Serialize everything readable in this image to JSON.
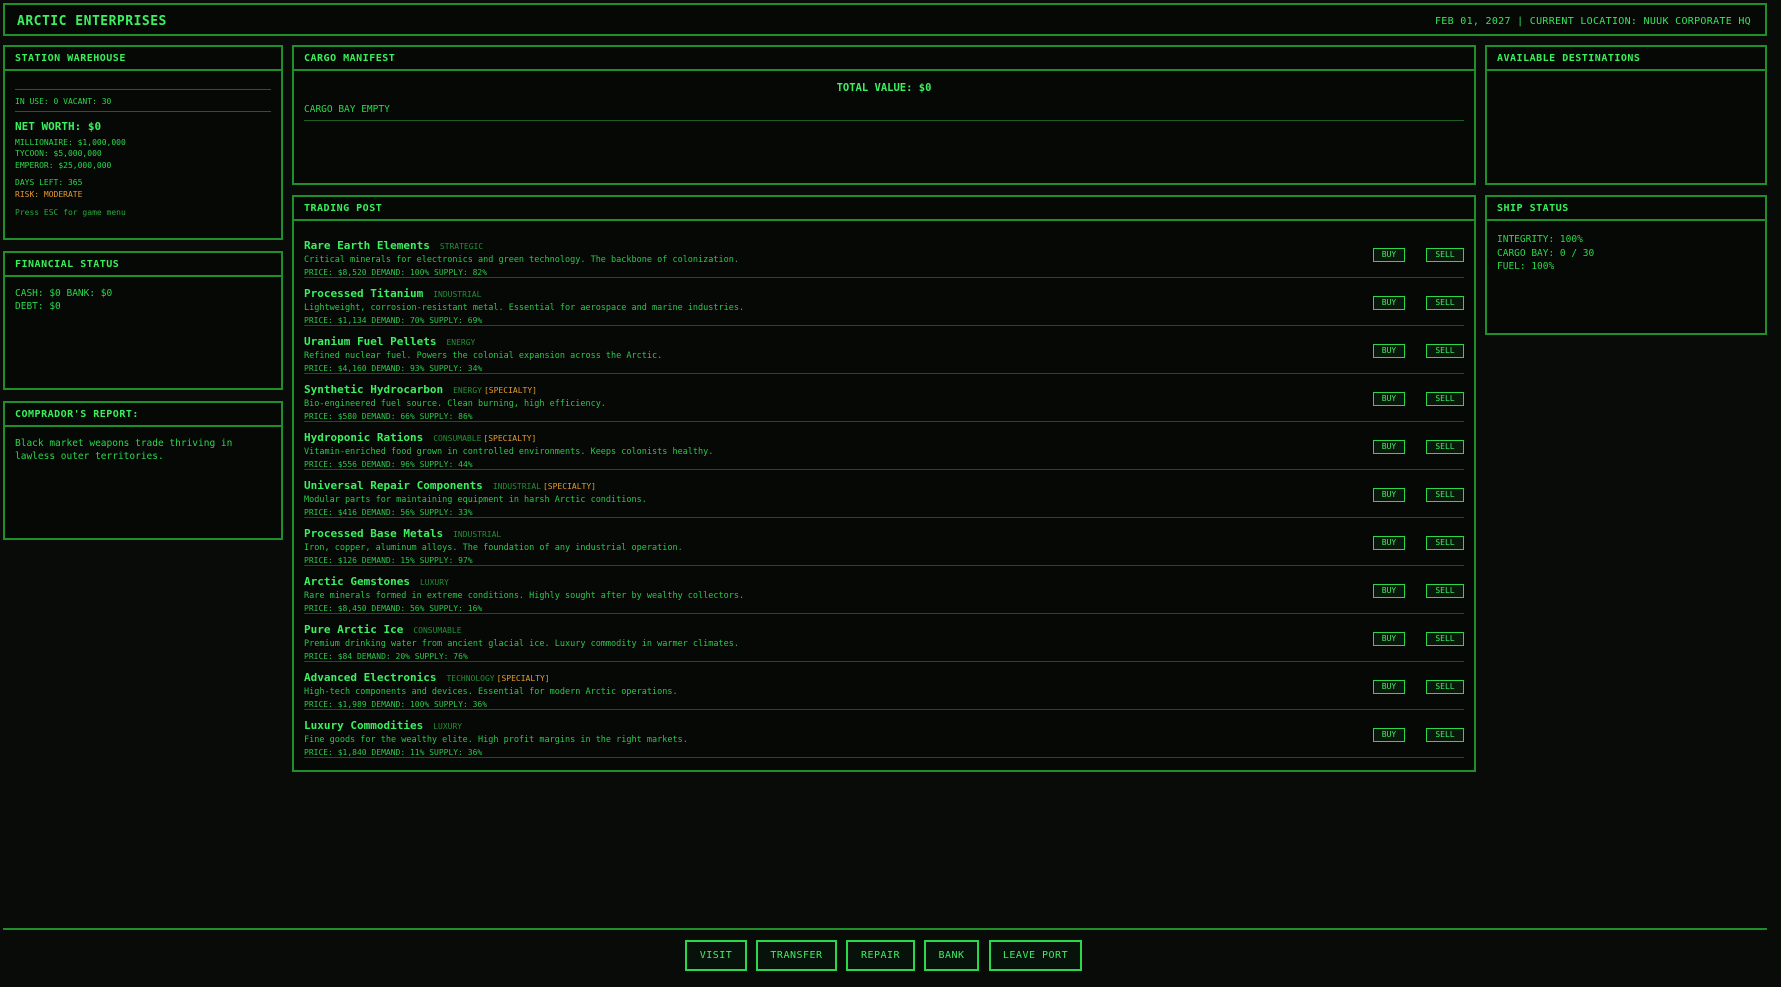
{
  "header": {
    "brand": "ARCTIC ENTERPRISES",
    "info": "FEB 01, 2027 | CURRENT LOCATION: NUUK CORPORATE HQ"
  },
  "warehouse": {
    "title": "STATION WAREHOUSE",
    "usage": "IN USE: 0 VACANT: 30",
    "net_worth": "NET WORTH: $0",
    "goals": [
      "MILLIONAIRE: $1,000,000",
      "TYCOON: $5,000,000",
      "EMPEROR: $25,000,000"
    ],
    "days_left": "DAYS LEFT: 365",
    "risk": "RISK: MODERATE",
    "hint": "Press ESC for game menu"
  },
  "financial": {
    "title": "FINANCIAL STATUS",
    "cash_bank": "CASH: $0 BANK: $0",
    "debt": "DEBT: $0"
  },
  "report": {
    "title": "COMPRADOR'S REPORT:",
    "text": "Black market weapons trade thriving in lawless outer territories."
  },
  "cargo": {
    "title": "CARGO MANIFEST",
    "total": "TOTAL VALUE: $0",
    "status": "CARGO BAY EMPTY"
  },
  "destinations": {
    "title": "AVAILABLE DESTINATIONS"
  },
  "ship": {
    "title": "SHIP STATUS",
    "integrity": "INTEGRITY: 100%",
    "cargo_bay": "CARGO BAY: 0 / 30",
    "fuel": "FUEL: 100%"
  },
  "trading": {
    "title": "TRADING POST",
    "buy_label": "BUY",
    "sell_label": "SELL",
    "items": [
      {
        "name": "Rare Earth Elements",
        "category": "STRATEGIC",
        "specialty": "",
        "desc": "Critical minerals for electronics and green technology. The backbone of colonization.",
        "stats": "PRICE: $8,520  DEMAND: 100%  SUPPLY: 82%"
      },
      {
        "name": "Processed Titanium",
        "category": "INDUSTRIAL",
        "specialty": "",
        "desc": "Lightweight, corrosion-resistant metal. Essential for aerospace and marine industries.",
        "stats": "PRICE: $1,134  DEMAND: 70%  SUPPLY: 69%"
      },
      {
        "name": "Uranium Fuel Pellets",
        "category": "ENERGY",
        "specialty": "",
        "desc": "Refined nuclear fuel. Powers the colonial expansion across the Arctic.",
        "stats": "PRICE: $4,160  DEMAND: 93%  SUPPLY: 34%"
      },
      {
        "name": "Synthetic Hydrocarbon",
        "category": "ENERGY",
        "specialty": "[SPECIALTY]",
        "desc": "Bio-engineered fuel source. Clean burning, high efficiency.",
        "stats": "PRICE: $580  DEMAND: 66%  SUPPLY: 86%"
      },
      {
        "name": "Hydroponic Rations",
        "category": "CONSUMABLE",
        "specialty": "[SPECIALTY]",
        "desc": "Vitamin-enriched food grown in controlled environments. Keeps colonists healthy.",
        "stats": "PRICE: $556  DEMAND: 96%  SUPPLY: 44%"
      },
      {
        "name": "Universal Repair Components",
        "category": "INDUSTRIAL",
        "specialty": "[SPECIALTY]",
        "desc": "Modular parts for maintaining equipment in harsh Arctic conditions.",
        "stats": "PRICE: $416  DEMAND: 56%  SUPPLY: 33%"
      },
      {
        "name": "Processed Base Metals",
        "category": "INDUSTRIAL",
        "specialty": "",
        "desc": "Iron, copper, aluminum alloys. The foundation of any industrial operation.",
        "stats": "PRICE: $126  DEMAND: 15%  SUPPLY: 97%"
      },
      {
        "name": "Arctic Gemstones",
        "category": "LUXURY",
        "specialty": "",
        "desc": "Rare minerals formed in extreme conditions. Highly sought after by wealthy collectors.",
        "stats": "PRICE: $8,450  DEMAND: 56%  SUPPLY: 16%"
      },
      {
        "name": "Pure Arctic Ice",
        "category": "CONSUMABLE",
        "specialty": "",
        "desc": "Premium drinking water from ancient glacial ice. Luxury commodity in warmer climates.",
        "stats": "PRICE: $84  DEMAND: 20%  SUPPLY: 76%"
      },
      {
        "name": "Advanced Electronics",
        "category": "TECHNOLOGY",
        "specialty": "[SPECIALTY]",
        "desc": "High-tech components and devices. Essential for modern Arctic operations.",
        "stats": "PRICE: $1,989  DEMAND: 100%  SUPPLY: 36%"
      },
      {
        "name": "Luxury Commodities",
        "category": "LUXURY",
        "specialty": "",
        "desc": "Fine goods for the wealthy elite. High profit margins in the right markets.",
        "stats": "PRICE: $1,840  DEMAND: 11%  SUPPLY: 36%"
      }
    ]
  },
  "nav": {
    "visit": "VISIT",
    "transfer": "TRANSFER",
    "repair": "REPAIR",
    "bank": "BANK",
    "leave": "LEAVE PORT"
  }
}
